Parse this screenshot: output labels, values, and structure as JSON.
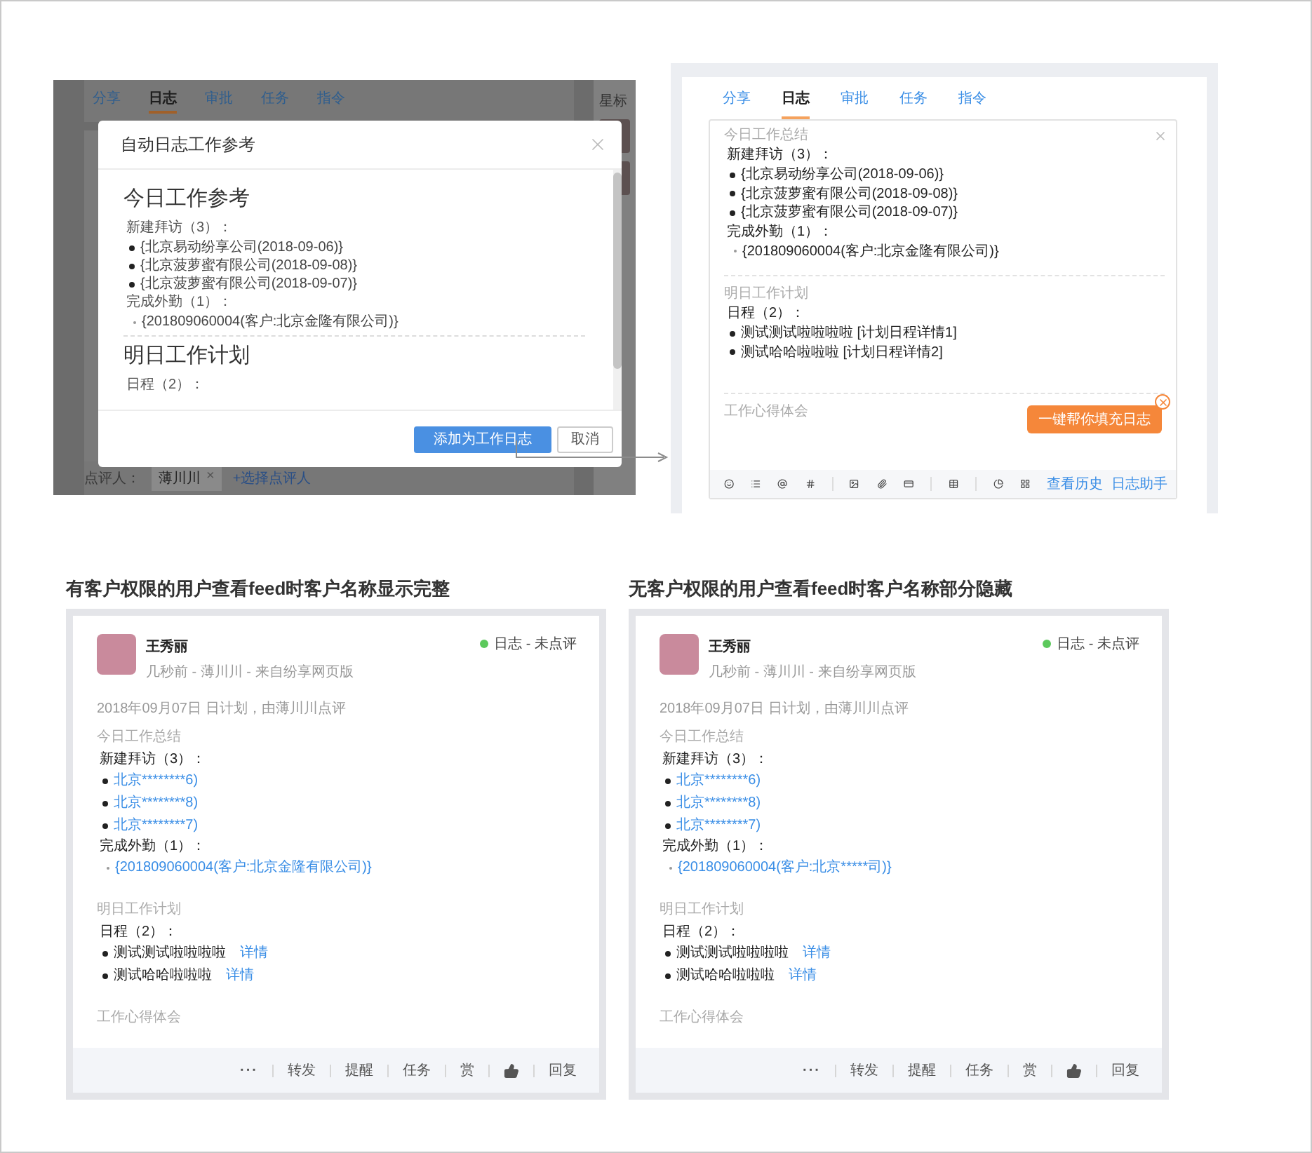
{
  "left_screen": {
    "tabs": [
      {
        "label": "分享",
        "selected": false
      },
      {
        "label": "日志",
        "selected": true
      },
      {
        "label": "审批",
        "selected": false
      },
      {
        "label": "任务",
        "selected": false
      },
      {
        "label": "指令",
        "selected": false
      }
    ],
    "side_label": "星标",
    "reviewer_label": "点评人：",
    "reviewer_tag": "薄川川",
    "tag_remove": "×",
    "add_reviewer": "+选择点评人",
    "dialog": {
      "title": "自动日志工作参考",
      "sections": [
        {
          "heading": "今日工作参考",
          "groups": [
            {
              "label": "新建拜访（3）：",
              "kind": "bullets",
              "items": [
                "{北京易动纷享公司(2018-09-06)}",
                "{北京菠萝蜜有限公司(2018-09-08)}",
                "{北京菠萝蜜有限公司(2018-09-07)}"
              ]
            },
            {
              "label": "完成外勤（1）：",
              "kind": "dots",
              "items": [
                "{201809060004(客户:北京金隆有限公司)}"
              ]
            }
          ]
        },
        {
          "heading": "明日工作计划",
          "groups": [
            {
              "label": "日程（2）："
            }
          ]
        }
      ],
      "buttons": [
        {
          "label": "添加为工作日志",
          "kind": "primary"
        },
        {
          "label": "取消",
          "kind": "secondary"
        }
      ]
    }
  },
  "editor_panel": {
    "tabs": [
      {
        "label": "分享",
        "selected": false
      },
      {
        "label": "日志",
        "selected": true
      },
      {
        "label": "审批",
        "selected": false
      },
      {
        "label": "任务",
        "selected": false
      },
      {
        "label": "指令",
        "selected": false
      }
    ],
    "sections": [
      {
        "title": "今日工作总结",
        "groups": [
          {
            "label": "新建拜访（3）：",
            "kind": "bullets",
            "items": [
              "{北京易动纷享公司(2018-09-06)}",
              "{北京菠萝蜜有限公司(2018-09-08)}",
              "{北京菠萝蜜有限公司(2018-09-07)}"
            ]
          },
          {
            "label": "完成外勤（1）：",
            "kind": "dots",
            "items": [
              "{201809060004(客户:北京金隆有限公司)}"
            ]
          }
        ]
      },
      {
        "title": "明日工作计划",
        "groups": [
          {
            "label": "日程（2）：",
            "kind": "bullets",
            "items": [
              "测试测试啦啦啦啦 [计划日程详情1]",
              "测试哈哈啦啦啦 [计划日程详情2]"
            ]
          }
        ]
      }
    ],
    "placeholder": "工作心得体会",
    "tooltip": "一键帮你填充日志",
    "links": [
      "查看历史",
      "日志助手"
    ]
  },
  "feed_cards": [
    {
      "caption": "有客户权限的用户查看feed时客户名称显示完整",
      "author": "王秀丽",
      "meta": "几秒前 - 薄川川 - 来自纷享网页版",
      "status": "日志 - 未点评",
      "date_line": "2018年09月07日 日计划，由薄川川点评",
      "sections": [
        {
          "title": "今日工作总结",
          "groups": [
            {
              "label": "新建拜访（3）：",
              "kind": "bullets",
              "items": [
                {
                  "text": "北京********6)",
                  "kind": "link"
                },
                {
                  "text": "北京********8)",
                  "kind": "link"
                },
                {
                  "text": "北京********7)",
                  "kind": "link"
                }
              ]
            },
            {
              "label": "完成外勤（1）：",
              "kind": "dots",
              "items": [
                {
                  "text": "{201809060004(客户:北京金隆有限公司)}",
                  "kind": "link"
                }
              ]
            }
          ]
        },
        {
          "title": "明日工作计划",
          "groups": [
            {
              "label": "日程（2）：",
              "kind": "bullets",
              "items": [
                {
                  "text": "测试测试啦啦啦啦",
                  "kind": "text",
                  "link": "详情"
                },
                {
                  "text": "测试哈哈啦啦啦",
                  "kind": "text",
                  "link": "详情"
                }
              ]
            }
          ]
        }
      ],
      "notes_label": "工作心得体会",
      "actions": [
        {
          "kind": "more",
          "label": "···"
        },
        {
          "kind": "text",
          "label": "转发"
        },
        {
          "kind": "text",
          "label": "提醒"
        },
        {
          "kind": "text",
          "label": "任务"
        },
        {
          "kind": "text",
          "label": "赏"
        },
        {
          "kind": "like"
        },
        {
          "kind": "text",
          "label": "回复"
        }
      ]
    },
    {
      "caption": "无客户权限的用户查看feed时客户名称部分隐藏",
      "author": "王秀丽",
      "meta": "几秒前 - 薄川川 - 来自纷享网页版",
      "status": "日志 - 未点评",
      "date_line": "2018年09月07日 日计划，由薄川川点评",
      "sections": [
        {
          "title": "今日工作总结",
          "groups": [
            {
              "label": "新建拜访（3）：",
              "kind": "bullets",
              "items": [
                {
                  "text": "北京********6)",
                  "kind": "link"
                },
                {
                  "text": "北京********8)",
                  "kind": "link"
                },
                {
                  "text": "北京********7)",
                  "kind": "link"
                }
              ]
            },
            {
              "label": "完成外勤（1）：",
              "kind": "dots",
              "items": [
                {
                  "text": "{201809060004(客户:北京*****司)}",
                  "kind": "link"
                }
              ]
            }
          ]
        },
        {
          "title": "明日工作计划",
          "groups": [
            {
              "label": "日程（2）：",
              "kind": "bullets",
              "items": [
                {
                  "text": "测试测试啦啦啦啦",
                  "kind": "text",
                  "link": "详情"
                },
                {
                  "text": "测试哈哈啦啦啦",
                  "kind": "text",
                  "link": "详情"
                }
              ]
            }
          ]
        }
      ],
      "notes_label": "工作心得体会",
      "actions": [
        {
          "kind": "more",
          "label": "···"
        },
        {
          "kind": "text",
          "label": "转发"
        },
        {
          "kind": "text",
          "label": "提醒"
        },
        {
          "kind": "text",
          "label": "任务"
        },
        {
          "kind": "text",
          "label": "赏"
        },
        {
          "kind": "like"
        },
        {
          "kind": "text",
          "label": "回复"
        }
      ]
    }
  ]
}
